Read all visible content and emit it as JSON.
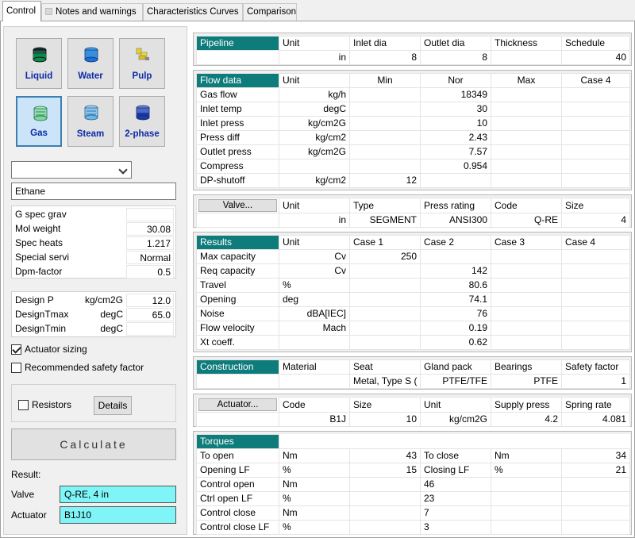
{
  "tabs": [
    {
      "label": "Control",
      "active": true,
      "check": false
    },
    {
      "label": "Notes and warnings",
      "active": false,
      "check": true
    },
    {
      "label": "Characteristics Curves",
      "active": false,
      "check": false
    },
    {
      "label": "Comparison",
      "active": false,
      "check": false
    }
  ],
  "fluid_buttons": [
    "Liquid",
    "Water",
    "Pulp",
    "Gas",
    "Steam",
    "2-phase"
  ],
  "selected_fluid": "Gas",
  "fluid_name": "Ethane",
  "combo_value": "",
  "props": {
    "g_spec_grav": {
      "label": "G spec grav",
      "value": ""
    },
    "mol_weight": {
      "label": "Mol weight",
      "value": "30.08"
    },
    "spec_heats": {
      "label": "Spec heats",
      "value": "1.217"
    },
    "special_servi": {
      "label": "Special servi",
      "value": "Normal"
    },
    "dpm_factor": {
      "label": "Dpm-factor",
      "value": "0.5"
    }
  },
  "design": {
    "p": {
      "label": "Design P",
      "unit": "kg/cm2G",
      "value": "12.0"
    },
    "tmax": {
      "label": "DesignTmax",
      "unit": "degC",
      "value": "65.0"
    },
    "tmin": {
      "label": "DesignTmin",
      "unit": "degC",
      "value": ""
    }
  },
  "actuator_sizing": {
    "label": "Actuator sizing",
    "checked": true
  },
  "recommended_safety": {
    "label": "Recommended safety factor",
    "checked": false
  },
  "resistors": {
    "label": "Resistors",
    "checked": false
  },
  "details_label": "Details",
  "calculate_label": "Calculate",
  "result": {
    "title": "Result:",
    "valve_label": "Valve",
    "valve_value": "Q-RE, 4 in",
    "actuator_label": "Actuator",
    "actuator_value": "B1J10"
  },
  "pipeline": {
    "headers": [
      "Pipeline",
      "Unit",
      "Inlet dia",
      "Outlet dia",
      "Thickness",
      "Schedule"
    ],
    "row": [
      "",
      "in",
      "8",
      "8",
      "",
      "40"
    ]
  },
  "flow": {
    "headers": [
      "Flow data",
      "Unit",
      "Min",
      "Nor",
      "Max",
      "Case 4"
    ],
    "rows": [
      [
        "Gas flow",
        "kg/h",
        "",
        "18349",
        "",
        ""
      ],
      [
        "Inlet temp",
        "degC",
        "",
        "30",
        "",
        ""
      ],
      [
        "Inlet press",
        "kg/cm2G",
        "",
        "10",
        "",
        ""
      ],
      [
        "Press diff",
        "kg/cm2",
        "",
        "2.43",
        "",
        ""
      ],
      [
        "Outlet press",
        "kg/cm2G",
        "",
        "7.57",
        "",
        ""
      ],
      [
        "Compress",
        "",
        "",
        "0.954",
        "",
        ""
      ],
      [
        "DP-shutoff",
        "kg/cm2",
        "12",
        "",
        "",
        ""
      ]
    ]
  },
  "valve": {
    "headers": [
      "Valve...",
      "Unit",
      "Type",
      "Press rating",
      "Code",
      "Size"
    ],
    "row": [
      "",
      "in",
      "SEGMENT",
      "ANSI300",
      "Q-RE",
      "4"
    ]
  },
  "results": {
    "headers": [
      "Results",
      "Unit",
      "Case 1",
      "Case 2",
      "Case 3",
      "Case 4"
    ],
    "rows": [
      [
        "Max capacity",
        "Cv",
        "250",
        "",
        "",
        ""
      ],
      [
        "Req capacity",
        "Cv",
        "",
        "142",
        "",
        ""
      ],
      [
        "Travel",
        "%",
        "",
        "80.6",
        "",
        ""
      ],
      [
        "Opening",
        "deg",
        "",
        "74.1",
        "",
        ""
      ],
      [
        "Noise",
        "dBA[IEC]",
        "",
        "76",
        "",
        ""
      ],
      [
        "Flow velocity",
        "Mach",
        "",
        "0.19",
        "",
        ""
      ],
      [
        "Xt coeff.",
        "",
        "",
        "0.62",
        "",
        ""
      ]
    ]
  },
  "construction": {
    "headers": [
      "Construction",
      "Material",
      "Seat",
      "Gland pack",
      "Bearings",
      "Safety factor"
    ],
    "row": [
      "",
      "",
      "Metal,  Type S (",
      "PTFE/TFE",
      "PTFE",
      "1"
    ]
  },
  "actuator": {
    "headers": [
      "Actuator...",
      "Code",
      "Size",
      "Unit",
      "Supply press",
      "Spring rate"
    ],
    "row": [
      "",
      "B1J",
      "10",
      "kg/cm2G",
      "4.2",
      "4.081"
    ]
  },
  "torques": {
    "header": "Torques",
    "rows": [
      [
        "To open",
        "Nm",
        "43",
        "To close",
        "Nm",
        "34"
      ],
      [
        "Opening LF",
        "%",
        "15",
        "Closing LF",
        "%",
        "21"
      ],
      [
        "Control open",
        "Nm",
        "",
        "46",
        "",
        ""
      ],
      [
        "Ctrl open LF",
        "%",
        "",
        "23",
        "",
        ""
      ],
      [
        "Control close",
        "Nm",
        "",
        "7",
        "",
        ""
      ],
      [
        "Control close LF",
        "%",
        "",
        "3",
        "",
        ""
      ]
    ]
  }
}
